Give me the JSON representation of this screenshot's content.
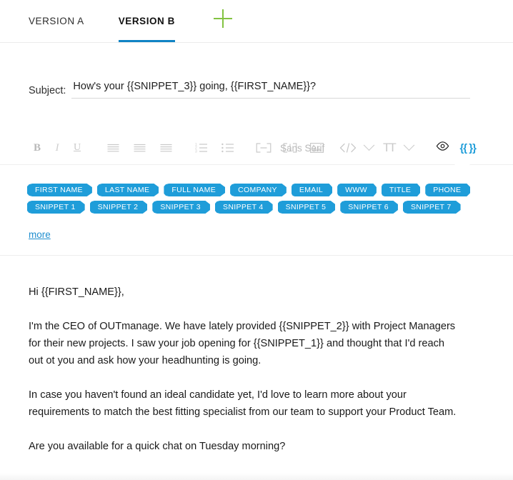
{
  "tabs": {
    "items": [
      {
        "label": "VERSION A",
        "active": false
      },
      {
        "label": "VERSION B",
        "active": true
      }
    ],
    "add_button_title": "Add version"
  },
  "subject": {
    "label": "Subject:",
    "value": "How's your {{SNIPPET_3}} going, {{FIRST_NAME}}?",
    "placeholder": "Subject"
  },
  "toolbar": {
    "bold": "B",
    "italic": "I",
    "underline": "U",
    "align_left": "align-left-icon",
    "align_center": "align-center-icon",
    "align_right": "align-right-icon",
    "ordered_list": "ordered-list-icon",
    "bullet_list": "bullet-list-icon",
    "link": "link-icon",
    "insert_placeholder": "insert-placeholder-icon",
    "image": "image-icon",
    "code": "code-icon",
    "font_family": "Sans Serif",
    "font_size_icon": "TT",
    "preview": "eye-icon",
    "snippets": "{{ }}",
    "accent_blue": "#1f9dd9"
  },
  "snippet_panel": {
    "rows": [
      [
        "FIRST NAME",
        "LAST NAME",
        "FULL NAME",
        "COMPANY",
        "EMAIL",
        "WWW",
        "TITLE",
        "PHONE"
      ],
      [
        "SNIPPET 1",
        "SNIPPET 2",
        "SNIPPET 3",
        "SNIPPET 4",
        "SNIPPET 5",
        "SNIPPET 6",
        "SNIPPET 7"
      ]
    ],
    "more_label": "more",
    "tag_color": "#1f9dd9"
  },
  "body": {
    "paragraphs": [
      "Hi {{FIRST_NAME}},",
      "I'm the CEO of OUTmanage. We have lately provided {{SNIPPET_2}} with Project Managers for their new projects. I saw your job opening for {{SNIPPET_1}} and thought that I'd reach out ot you and ask how your headhunting is going.",
      "In case you haven't found an ideal candidate yet, I'd love to learn more about your requirements to match the best fitting specialist from our team to support your Product Team.",
      "Are you available for a quick chat on Tuesday morning?"
    ]
  },
  "colors": {
    "tab_underline": "#1083c5",
    "add_icon": "#83c341",
    "link": "#1f8ecf"
  }
}
